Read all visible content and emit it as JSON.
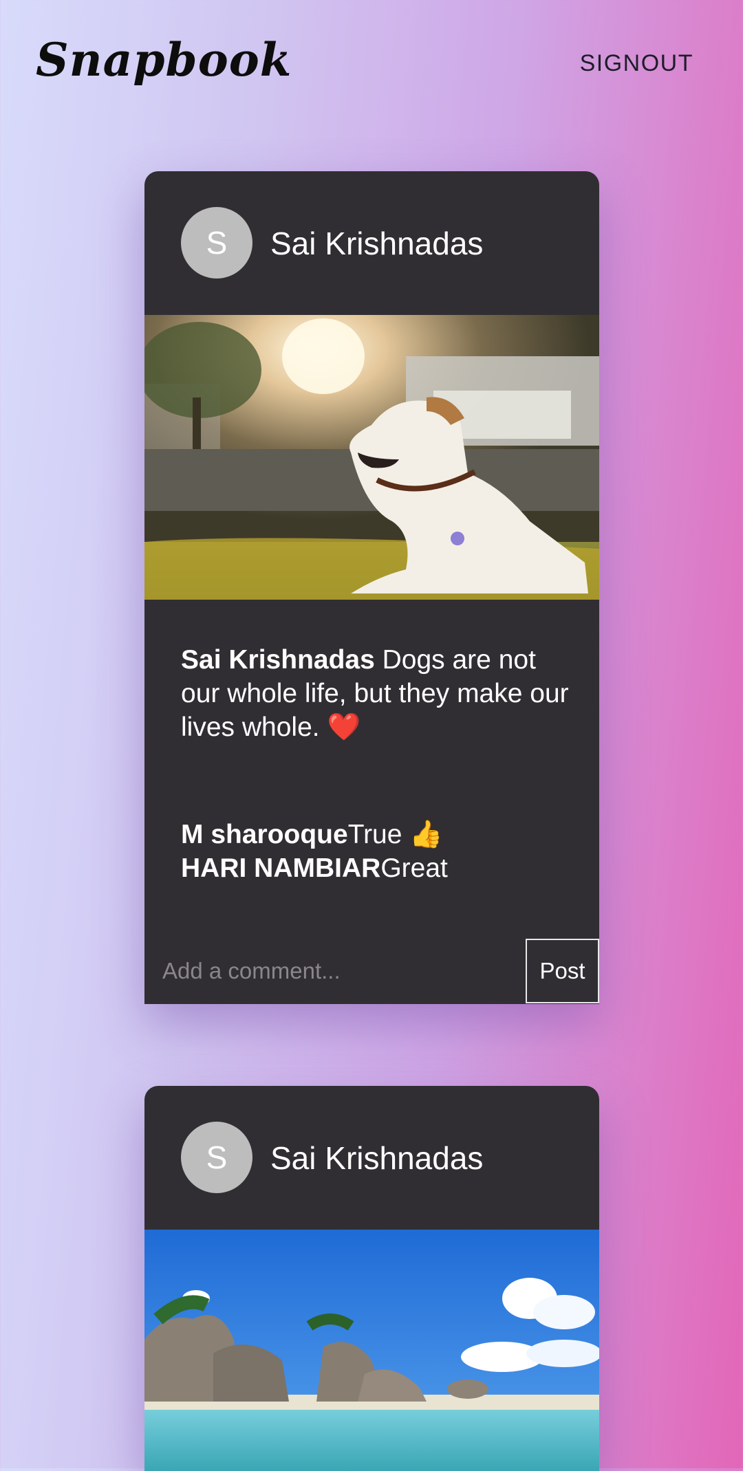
{
  "app": {
    "logo": "Snapbook",
    "signout_label": "SIGNOUT"
  },
  "posts": [
    {
      "avatar_letter": "S",
      "username": "Sai Krishnadas",
      "image": "photo of a white dog lying on sunlit grass",
      "caption_author": "Sai Krishnadas",
      "caption_text": " Dogs are not our whole life, but they make our lives whole. ",
      "caption_emoji": "❤️",
      "comments": [
        {
          "author": "M sharooque",
          "text": "True 👍"
        },
        {
          "author": "HARI NAMBIAR",
          "text": "Great"
        }
      ],
      "comment_placeholder": "Add a comment...",
      "post_label": "Post"
    },
    {
      "avatar_letter": "S",
      "username": "Sai Krishnadas",
      "image": "photo of a tropical beach with granite rocks and blue sky"
    }
  ],
  "colors": {
    "card_bg": "#312e33",
    "avatar_bg": "#bdbdbd",
    "heart": "#e52b2b"
  }
}
